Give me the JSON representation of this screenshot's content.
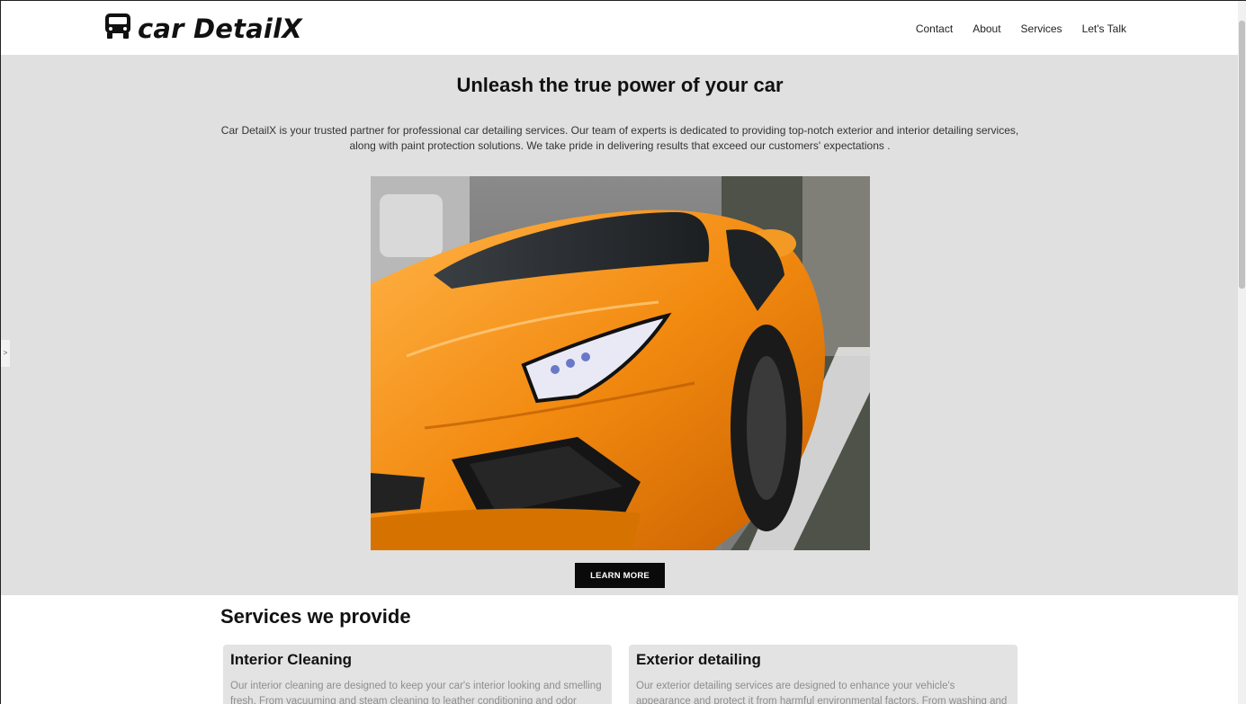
{
  "header": {
    "logo_text": "car DetailX",
    "logo_icon": "van-icon",
    "nav": [
      {
        "label": "Contact"
      },
      {
        "label": "About"
      },
      {
        "label": "Services"
      },
      {
        "label": "Let's Talk"
      }
    ]
  },
  "hero": {
    "title": "Unleash the true power of your car",
    "description": "Car DetailX is your trusted partner for professional car detailing services. Our team of experts is dedicated to providing top-notch exterior and interior detailing services, along with paint protection solutions. We take pride in delivering results that exceed our customers' expectations .",
    "button_label": "LEARN MORE"
  },
  "services": {
    "title": "Services we provide",
    "cards": [
      {
        "title": "Interior Cleaning",
        "text": "Our interior cleaning are designed to keep your car's interior looking and smelling fresh. From vacuuming and steam cleaning to leather conditioning and odor"
      },
      {
        "title": "Exterior detailing",
        "text": "Our exterior detailing services are designed to enhance your vehicle's appearance and protect it from harmful environmental factors. From washing and waxing to"
      }
    ]
  },
  "side_toggle": ">",
  "colors": {
    "hero_bg": "#e0e0e0",
    "button_bg": "#0a0a0a",
    "card_bg": "#e3e3e3",
    "car_orange": "#f08a12"
  }
}
